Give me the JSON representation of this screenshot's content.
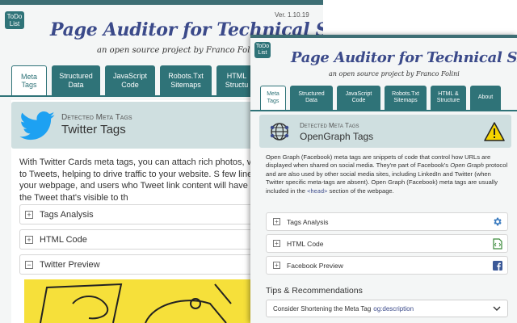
{
  "back": {
    "todo_line1": "ToDo",
    "todo_line2": "List",
    "version": "Ver. 1.10.19",
    "title": "Page Auditor for Technical SEO",
    "subtitle": "an open source project by Franco Folini",
    "tabs": [
      {
        "l1": "Meta",
        "l2": "Tags"
      },
      {
        "l1": "Structured",
        "l2": "Data"
      },
      {
        "l1": "JavaScript",
        "l2": "Code"
      },
      {
        "l1": "Robots.Txt",
        "l2": "Sitemaps"
      },
      {
        "l1": "HTML",
        "l2": "Structu"
      }
    ],
    "detected": "Detected Meta Tags",
    "section_title": "Twitter Tags",
    "paragraph": "With Twitter Cards meta tags, you can attach rich photos, video experiences to Tweets, helping to drive traffic to your website. S few lines of markup to your webpage, and users who Tweet link content will have a \"Card\" added to the Tweet that's visible to th",
    "accordions": [
      "Tags Analysis",
      "HTML Code",
      "Twitter Preview"
    ]
  },
  "front": {
    "todo_line1": "ToDo",
    "todo_line2": "List",
    "title": "Page Auditor for Technical SEO",
    "subtitle": "an open source project by Franco Folini",
    "tabs": [
      {
        "l1": "Meta",
        "l2": "Tags"
      },
      {
        "l1": "Structured",
        "l2": "Data"
      },
      {
        "l1": "JavaScript",
        "l2": "Code"
      },
      {
        "l1": "Robots.Txt",
        "l2": "Sitemaps"
      },
      {
        "l1": "HTML &",
        "l2": "Structure"
      },
      {
        "l1": "About",
        "l2": ""
      }
    ],
    "detected": "Detected Meta Tags",
    "section_title": "OpenGraph Tags",
    "para_1": "Open Graph (Facebook) meta tags are snippets of code that control how URLs are displayed when shared on social media. They're part of Facebook's",
    "para_em": "Open Graph",
    "para_2": "protocol and are also used by other social media sites, including LinkedIn and Twitter (when Twitter specific meta-tags are absent). Open Graph (Facebook) meta tags are usually included in the",
    "para_code": "<head>",
    "para_3": "section of the webpage.",
    "accordions": [
      "Tags Analysis",
      "HTML Code",
      "Facebook Preview"
    ],
    "tips_heading": "Tips & Recommendations",
    "tip_text": "Consider Shortening the Meta Tag",
    "tip_code": "og:description"
  },
  "colors": {
    "teal": "#2f7378",
    "title_blue": "#3b4a8a",
    "header_box": "#cfdfe0",
    "twitter_blue": "#1da1f2",
    "facebook_blue": "#3b5998",
    "warning_yellow": "#f5d400"
  }
}
